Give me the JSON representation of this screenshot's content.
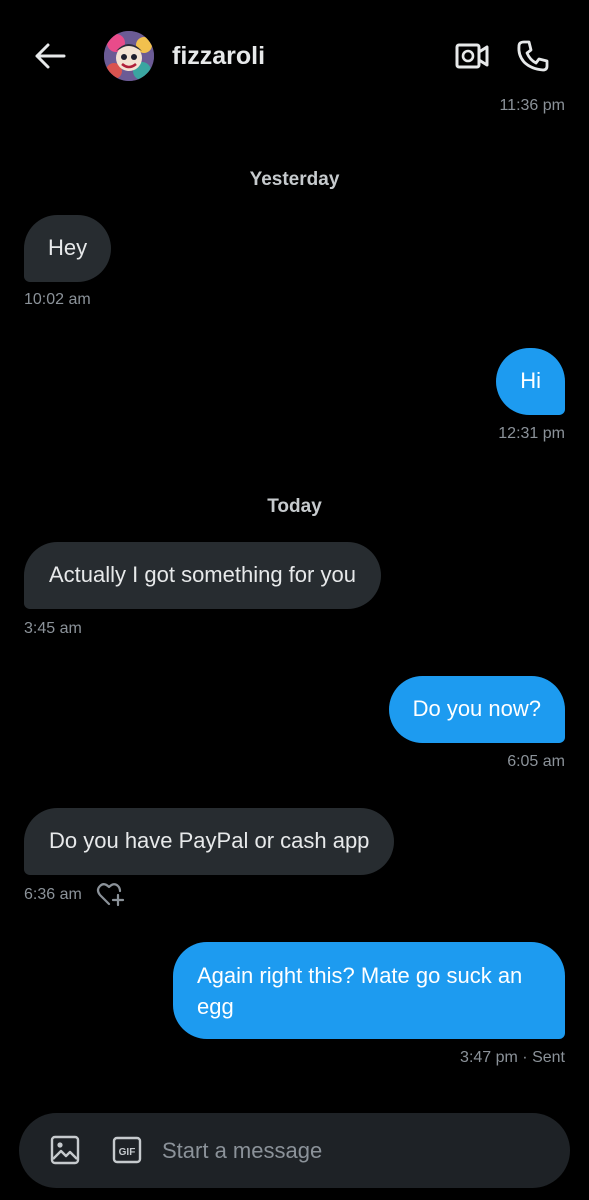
{
  "header": {
    "username": "fizzaroli",
    "icons": {
      "back": "arrow-left-icon",
      "video": "video-camera-icon",
      "call": "phone-icon"
    }
  },
  "top_timestamp": "11:36 pm",
  "day_separators": {
    "yesterday": "Yesterday",
    "today": "Today"
  },
  "messages": [
    {
      "direction": "in",
      "text": "Hey",
      "time": "10:02 am"
    },
    {
      "direction": "out",
      "text": "Hi",
      "time": "12:31 pm"
    },
    {
      "direction": "in",
      "text": "Actually I got something for you",
      "time": "3:45 am"
    },
    {
      "direction": "out",
      "text": "Do you now?",
      "time": "6:05 am"
    },
    {
      "direction": "in",
      "text": "Do you have PayPal or cash app",
      "time": "6:36 am"
    },
    {
      "direction": "out",
      "text": "Again right this? Mate go suck an egg",
      "time": "3:47 pm · Sent"
    }
  ],
  "composer": {
    "placeholder": "Start a message",
    "gif_label": "GIF"
  },
  "colors": {
    "background": "#000000",
    "incoming_bubble": "#272c30",
    "outgoing_bubble": "#1d9bf0",
    "timestamp": "#8b9299",
    "voice_accent": "#7b61ff"
  }
}
